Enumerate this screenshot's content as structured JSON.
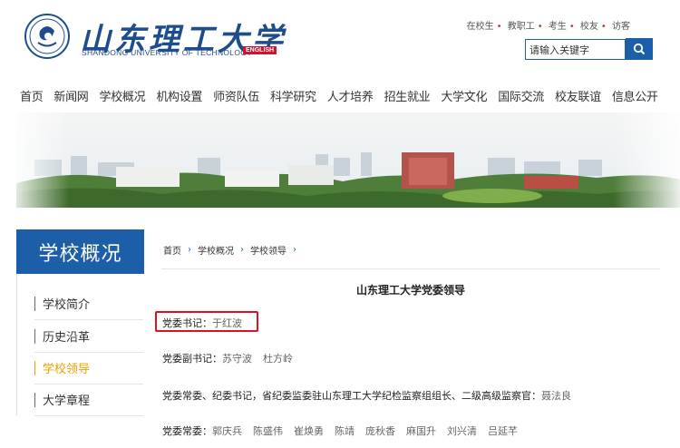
{
  "header": {
    "logo_cn": "山东理工大学",
    "logo_en": "SHANDONG UNIVERSITY OF TECHNOLOGY",
    "english_label": "ENGLISH",
    "top_links": [
      "在校生",
      "教职工",
      "考生",
      "校友",
      "访客"
    ],
    "search_placeholder": "请输入关键字",
    "search_icon": "magnifier-icon"
  },
  "nav": {
    "items": [
      "首页",
      "新闻网",
      "学校概况",
      "机构设置",
      "师资队伍",
      "科学研究",
      "人才培养",
      "招生就业",
      "大学文化",
      "国际交流",
      "校友联谊",
      "信息公开"
    ]
  },
  "sidebar": {
    "title": "学校概况",
    "items": [
      {
        "label": "学校简介",
        "active": false
      },
      {
        "label": "历史沿革",
        "active": false
      },
      {
        "label": "学校领导",
        "active": true
      },
      {
        "label": "大学章程",
        "active": false
      }
    ]
  },
  "breadcrumb": [
    "首页",
    "学校概况",
    "学校领导"
  ],
  "content": {
    "title": "山东理工大学党委领导",
    "rows": [
      {
        "label": "党委书记：",
        "names": [
          "于红波"
        ]
      },
      {
        "label": "党委副书记：",
        "names": [
          "苏守波",
          "杜方岭"
        ]
      },
      {
        "label": "党委常委、纪委书记，省纪委监委驻山东理工大学纪检监察组组长、二级高级监察官：",
        "names": [
          "聂法良"
        ]
      },
      {
        "label": "党委常委：",
        "names": [
          "郭庆兵",
          "陈盛伟",
          "崔焕勇",
          "陈靖",
          "庞秋香",
          "麻国升",
          "刘兴清",
          "吕延芊"
        ]
      }
    ]
  },
  "colors": {
    "brand_blue": "#1d5ea8",
    "active_yellow": "#e8a400",
    "highlight_red": "#e0101e",
    "english_red": "#d6102d"
  }
}
